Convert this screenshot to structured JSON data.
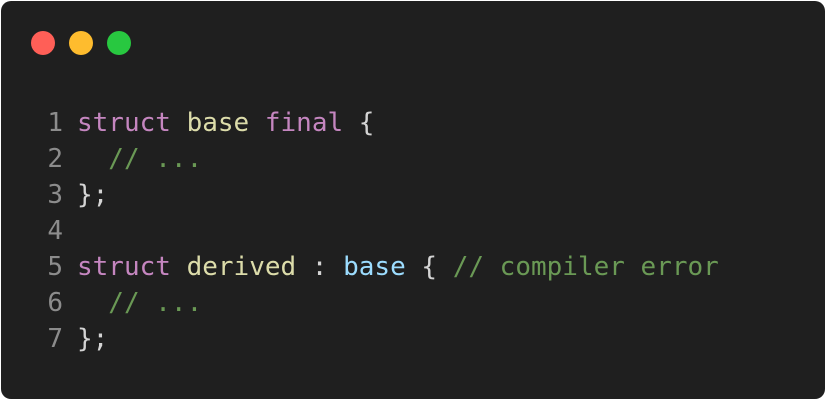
{
  "window": {
    "buttons": {
      "close_color": "#ff5f57",
      "minimize_color": "#febc2e",
      "zoom_color": "#28c840"
    }
  },
  "colors": {
    "keyword": "#c586c0",
    "type": "#dcdcaa",
    "base_ref": "#9cdcfe",
    "comment": "#6a9955",
    "punct": "#d4d4d4",
    "line_number": "#8c8c8c"
  },
  "code": {
    "lines": [
      {
        "number": "1",
        "tokens": [
          {
            "text": "struct",
            "kind": "keyword"
          },
          {
            "text": " ",
            "kind": "punct"
          },
          {
            "text": "base",
            "kind": "type"
          },
          {
            "text": " ",
            "kind": "punct"
          },
          {
            "text": "final",
            "kind": "keyword"
          },
          {
            "text": " {",
            "kind": "punct"
          }
        ]
      },
      {
        "number": "2",
        "tokens": [
          {
            "text": "  // ...",
            "kind": "comment"
          }
        ]
      },
      {
        "number": "3",
        "tokens": [
          {
            "text": "};",
            "kind": "punct"
          }
        ]
      },
      {
        "number": "4",
        "tokens": []
      },
      {
        "number": "5",
        "tokens": [
          {
            "text": "struct",
            "kind": "keyword"
          },
          {
            "text": " ",
            "kind": "punct"
          },
          {
            "text": "derived",
            "kind": "type"
          },
          {
            "text": " : ",
            "kind": "punct"
          },
          {
            "text": "base",
            "kind": "base_ref"
          },
          {
            "text": " { ",
            "kind": "punct"
          },
          {
            "text": "// compiler error",
            "kind": "comment"
          }
        ]
      },
      {
        "number": "6",
        "tokens": [
          {
            "text": "  // ...",
            "kind": "comment"
          }
        ]
      },
      {
        "number": "7",
        "tokens": [
          {
            "text": "};",
            "kind": "punct"
          }
        ]
      }
    ]
  }
}
